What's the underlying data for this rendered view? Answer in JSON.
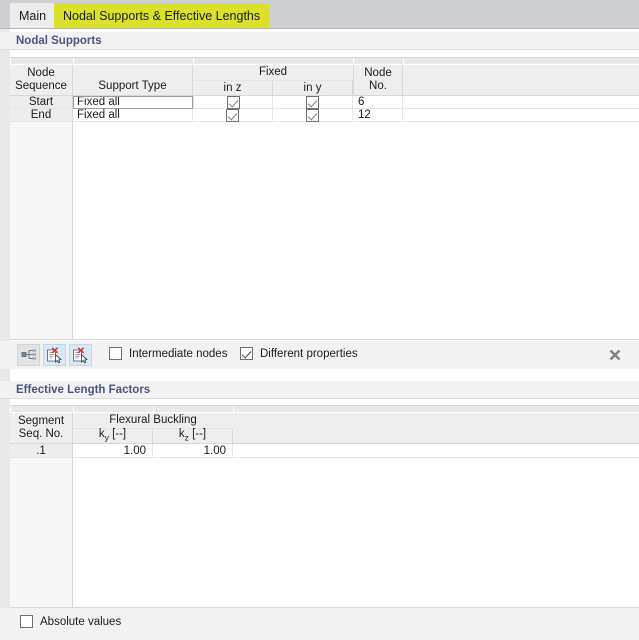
{
  "tabs": [
    {
      "label": "Main",
      "active": false
    },
    {
      "label": "Nodal Supports & Effective Lengths",
      "active": true
    }
  ],
  "colors": {
    "tab_highlight": "#dbe02b",
    "section_title": "#4a5580",
    "header_bg": "#eeeeee",
    "grid_line": "#d7d7d7",
    "panel_bg": "#f2f2f2"
  },
  "nodal_supports": {
    "section_title": "Nodal Supports",
    "columns": {
      "node_sequence": "Node\nSequence",
      "node_sequence_l1": "Node",
      "node_sequence_l2": "Sequence",
      "support_type": "Support Type",
      "fixed_group": "Fixed",
      "in_z": "in z",
      "in_y": "in y",
      "node_no_l1": "Node",
      "node_no_l2": "No."
    },
    "rows": [
      {
        "sequence": "Start",
        "support_type": "Fixed all",
        "in_z": true,
        "in_y": true,
        "node_no": "6",
        "focused": true
      },
      {
        "sequence": "End",
        "support_type": "Fixed all",
        "in_z": true,
        "in_y": true,
        "node_no": "12",
        "focused": false
      }
    ],
    "toolbar": {
      "buttons": [
        {
          "name": "list-hierarchy-icon",
          "title": ""
        },
        {
          "name": "delete-row-icon",
          "title": ""
        },
        {
          "name": "delete-all-rows-icon",
          "title": ""
        }
      ],
      "intermediate_nodes": {
        "label": "Intermediate nodes",
        "checked": false
      },
      "different_properties": {
        "label": "Different properties",
        "checked": true
      },
      "close_label": "✕"
    }
  },
  "effective_lengths": {
    "section_title": "Effective Length Factors",
    "columns": {
      "segment_l1": "Segment",
      "segment_l2": "Seq. No.",
      "flexural_buckling": "Flexural Buckling",
      "ky": "ky [--]",
      "ky_base": "k",
      "ky_sub": "y",
      "ky_unit": " [--]",
      "kz": "kz [--]",
      "kz_base": "k",
      "kz_sub": "z",
      "kz_unit": " [--]"
    },
    "rows": [
      {
        "segment": ".1",
        "ky": "1.00",
        "kz": "1.00"
      }
    ],
    "absolute_values": {
      "label": "Absolute values",
      "checked": false
    }
  }
}
